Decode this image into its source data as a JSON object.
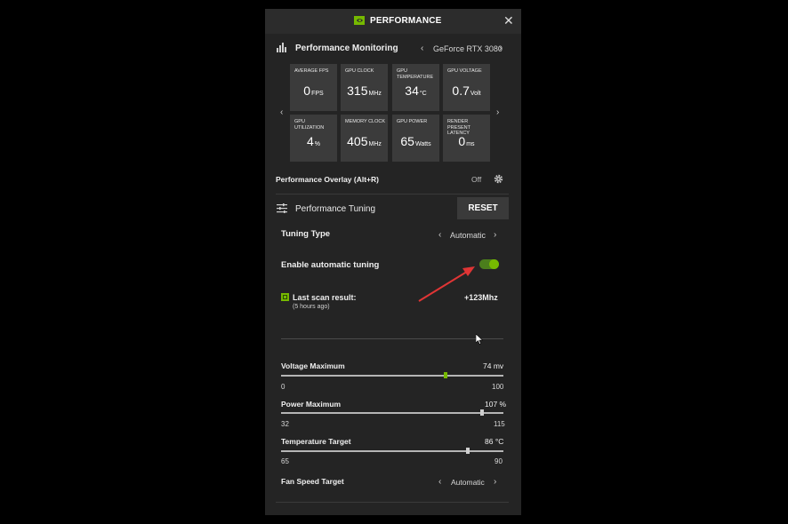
{
  "header": {
    "title": "PERFORMANCE"
  },
  "monitoring": {
    "title": "Performance Monitoring",
    "gpu_name": "GeForce RTX 3080",
    "tiles": [
      {
        "label": "AVERAGE FPS",
        "value": "0",
        "unit": "FPS"
      },
      {
        "label": "GPU CLOCK",
        "value": "315",
        "unit": "MHz"
      },
      {
        "label": "GPU TEMPERATURE",
        "value": "34",
        "unit": "°C"
      },
      {
        "label": "GPU VOLTAGE",
        "value": "0.7",
        "unit": "Volt"
      },
      {
        "label": "GPU UTILIZATION",
        "value": "4",
        "unit": "%"
      },
      {
        "label": "MEMORY CLOCK",
        "value": "405",
        "unit": "MHz"
      },
      {
        "label": "GPU POWER",
        "value": "65",
        "unit": "Watts"
      },
      {
        "label": "RENDER PRESENT LATENCY",
        "value": "0",
        "unit": "ms"
      }
    ]
  },
  "overlay": {
    "label": "Performance Overlay (Alt+R)",
    "state": "Off"
  },
  "tuning": {
    "title": "Performance Tuning",
    "reset_label": "RESET",
    "type_label": "Tuning Type",
    "type_value": "Automatic",
    "auto_label": "Enable automatic tuning",
    "auto_enabled": true,
    "scan_label": "Last scan result:",
    "scan_time": "(5 hours ago)",
    "scan_value": "+123Mhz",
    "sliders": [
      {
        "label": "Voltage Maximum",
        "value": "74 mv",
        "min": "0",
        "max": "100",
        "level": 0.74
      },
      {
        "label": "Power Maximum",
        "value": "107 %",
        "min": "32",
        "max": "115",
        "level": 0.904
      },
      {
        "label": "Temperature Target",
        "value": "86 °C",
        "min": "65",
        "max": "90",
        "level": 0.84
      }
    ],
    "fan_label": "Fan Speed Target",
    "fan_value": "Automatic"
  }
}
